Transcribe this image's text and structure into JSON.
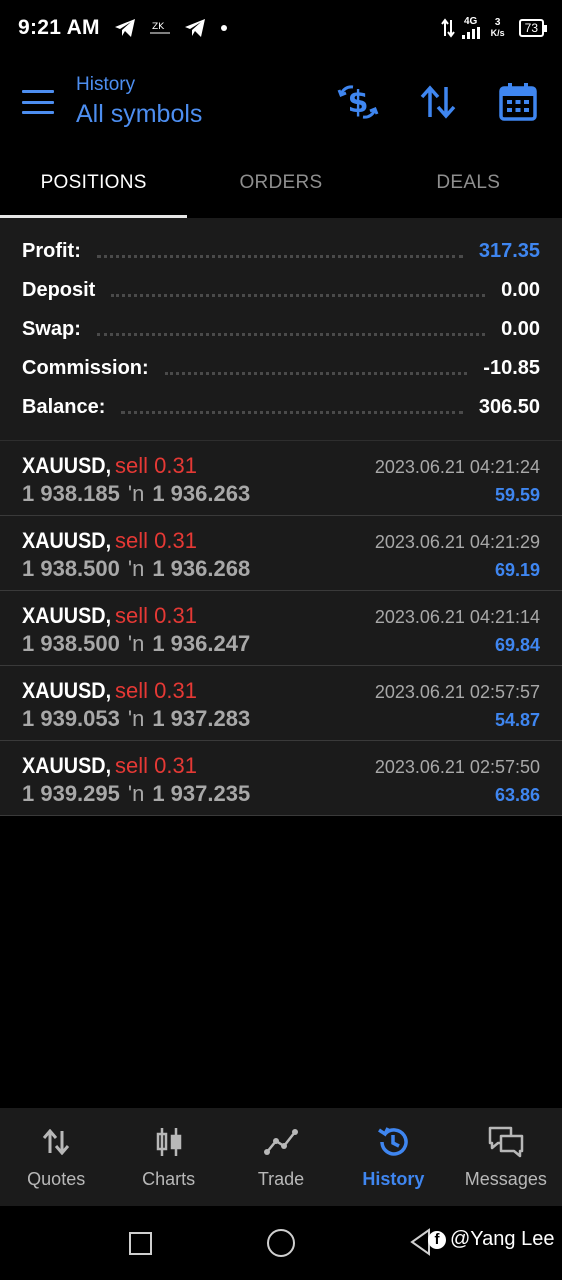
{
  "status_bar": {
    "time": "9:21 AM",
    "network": "4G",
    "speed_value": "3",
    "speed_unit": "K/s",
    "battery": "73"
  },
  "header": {
    "subtitle": "History",
    "title": "All symbols",
    "icons": [
      "menu-icon",
      "dollar-exchange-icon",
      "sort-icon",
      "calendar-icon"
    ]
  },
  "tabs": [
    {
      "label": "POSITIONS",
      "active": true
    },
    {
      "label": "ORDERS",
      "active": false
    },
    {
      "label": "DEALS",
      "active": false
    }
  ],
  "summary": {
    "profit": {
      "label": "Profit:",
      "value": "317.35"
    },
    "deposit": {
      "label": "Deposit",
      "value": "0.00"
    },
    "swap": {
      "label": "Swap:",
      "value": "0.00"
    },
    "commission": {
      "label": "Commission:",
      "value": "-10.85"
    },
    "balance": {
      "label": "Balance:",
      "value": "306.50"
    }
  },
  "deals": [
    {
      "symbol": "XAUUSD,",
      "side": "sell 0.31",
      "open_price": "1 938.185",
      "arrow": "'n",
      "close_price": "1 936.263",
      "time": "2023.06.21 04:21:24",
      "profit": "59.59"
    },
    {
      "symbol": "XAUUSD,",
      "side": "sell 0.31",
      "open_price": "1 938.500",
      "arrow": "'n",
      "close_price": "1 936.268",
      "time": "2023.06.21 04:21:29",
      "profit": "69.19"
    },
    {
      "symbol": "XAUUSD,",
      "side": "sell 0.31",
      "open_price": "1 938.500",
      "arrow": "'n",
      "close_price": "1 936.247",
      "time": "2023.06.21 04:21:14",
      "profit": "69.84"
    },
    {
      "symbol": "XAUUSD,",
      "side": "sell 0.31",
      "open_price": "1 939.053",
      "arrow": "'n",
      "close_price": "1 937.283",
      "time": "2023.06.21 02:57:57",
      "profit": "54.87"
    },
    {
      "symbol": "XAUUSD,",
      "side": "sell 0.31",
      "open_price": "1 939.295",
      "arrow": "'n",
      "close_price": "1 937.235",
      "time": "2023.06.21 02:57:50",
      "profit": "63.86"
    }
  ],
  "bottom_nav": [
    {
      "label": "Quotes",
      "icon": "quotes-icon",
      "active": false
    },
    {
      "label": "Charts",
      "icon": "charts-icon",
      "active": false
    },
    {
      "label": "Trade",
      "icon": "trade-icon",
      "active": false
    },
    {
      "label": "History",
      "icon": "history-icon",
      "active": true
    },
    {
      "label": "Messages",
      "icon": "messages-icon",
      "active": false
    }
  ],
  "watermark": "@Yang Lee",
  "colors": {
    "accent_blue": "#3f86f0",
    "sell_red": "#e53935",
    "panel_bg": "#1b1b1b"
  }
}
